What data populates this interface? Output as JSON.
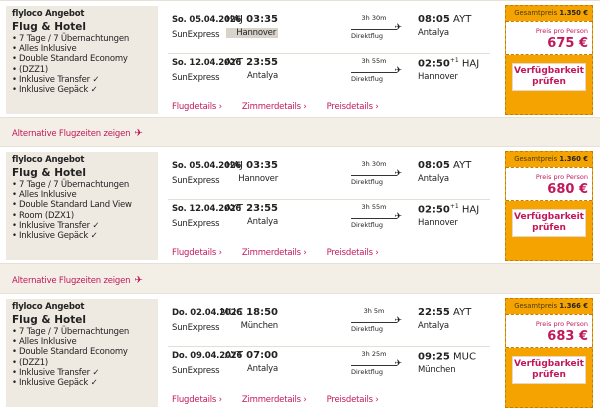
{
  "offers": [
    {
      "brand": "flyloco Angebot",
      "title": "Flug & Hotel",
      "features": [
        "7 Tage / 7 Übernachtungen",
        "Alles Inklusive",
        "Double Standard Economy",
        "(DZZ1)",
        "Inklusive Transfer ✓",
        "Inklusive Gepäck ✓"
      ],
      "flights": [
        {
          "date": "So. 05.04.2026",
          "airline": "SunExpress",
          "dep_code": "HAJ",
          "dep_time": "03:35",
          "dep_city": "Hannover",
          "duration": "3h 30m",
          "type": "Direktflug",
          "arr_time": "08:05",
          "arr_code": "AYT",
          "arr_city": "Antalya",
          "plus": ""
        },
        {
          "date": "So. 12.04.2026",
          "airline": "SunExpress",
          "dep_code": "AYT",
          "dep_time": "23:55",
          "dep_city": "Antalya",
          "duration": "3h 55m",
          "type": "Direktflug",
          "arr_time": "02:50",
          "arr_code": "HAJ",
          "arr_city": "Hannover",
          "plus": "+1"
        }
      ],
      "links": [
        "Flugdetails",
        "Zimmerdetails",
        "Preisdetails"
      ],
      "total_label": "Gesamtpreis",
      "total_value": "1.350 €",
      "per_person_label": "Preis pro Person",
      "price": "675 €",
      "button": "Verfügbarkeit prüfen"
    },
    {
      "brand": "flyloco Angebot",
      "title": "Flug & Hotel",
      "features": [
        "7 Tage / 7 Übernachtungen",
        "Alles Inklusive",
        "Double Standard Land View",
        "Room (DZX1)",
        "Inklusive Transfer ✓",
        "Inklusive Gepäck ✓"
      ],
      "flights": [
        {
          "date": "So. 05.04.2026",
          "airline": "SunExpress",
          "dep_code": "HAJ",
          "dep_time": "03:35",
          "dep_city": "Hannover",
          "duration": "3h 30m",
          "type": "Direktflug",
          "arr_time": "08:05",
          "arr_code": "AYT",
          "arr_city": "Antalya",
          "plus": ""
        },
        {
          "date": "So. 12.04.2026",
          "airline": "SunExpress",
          "dep_code": "AYT",
          "dep_time": "23:55",
          "dep_city": "Antalya",
          "duration": "3h 55m",
          "type": "Direktflug",
          "arr_time": "02:50",
          "arr_code": "HAJ",
          "arr_city": "Hannover",
          "plus": "+1"
        }
      ],
      "links": [
        "Flugdetails",
        "Zimmerdetails",
        "Preisdetails"
      ],
      "total_label": "Gesamtpreis",
      "total_value": "1.360 €",
      "per_person_label": "Preis pro Person",
      "price": "680 €",
      "button": "Verfügbarkeit prüfen"
    },
    {
      "brand": "flyloco Angebot",
      "title": "Flug & Hotel",
      "features": [
        "7 Tage / 7 Übernachtungen",
        "Alles Inklusive",
        "Double Standard Economy",
        "(DZZ1)",
        "Inklusive Transfer ✓",
        "Inklusive Gepäck ✓"
      ],
      "flights": [
        {
          "date": "Do. 02.04.2026",
          "airline": "SunExpress",
          "dep_code": "MUC",
          "dep_time": "18:50",
          "dep_city": "München",
          "duration": "3h 5m",
          "type": "Direktflug",
          "arr_time": "22:55",
          "arr_code": "AYT",
          "arr_city": "Antalya",
          "plus": ""
        },
        {
          "date": "Do. 09.04.2026",
          "airline": "SunExpress",
          "dep_code": "AYT",
          "dep_time": "07:00",
          "dep_city": "Antalya",
          "duration": "3h 25m",
          "type": "Direktflug",
          "arr_time": "09:25",
          "arr_code": "MUC",
          "arr_city": "München",
          "plus": ""
        }
      ],
      "links": [
        "Flugdetails",
        "Zimmerdetails",
        "Preisdetails"
      ],
      "total_label": "Gesamtpreis",
      "total_value": "1.366 €",
      "per_person_label": "Preis pro Person",
      "price": "683 €",
      "button": "Verfügbarkeit prüfen"
    }
  ],
  "alt_times_label": "Alternative Flugzeiten zeigen",
  "colors": {
    "accent": "#c2185b",
    "price_box": "#f5a300",
    "page_bg": "#f3eee6"
  }
}
